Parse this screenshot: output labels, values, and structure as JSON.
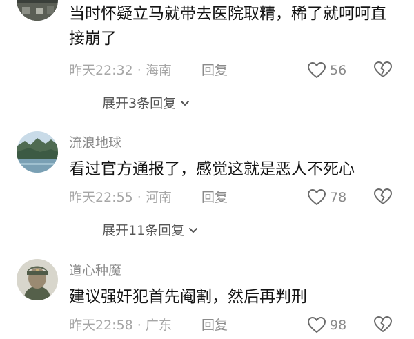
{
  "comments": [
    {
      "text": "当时怀疑立马就带去医院取精，稀了就呵呵直接崩了",
      "time": "昨天22:32",
      "location": "海南",
      "reply_label": "回复",
      "likes": "56",
      "expand_label": "展开3条回复"
    },
    {
      "username": "流浪地球",
      "text": "看过官方通报了，感觉这就是恶人不死心",
      "time": "昨天22:55",
      "location": "河南",
      "reply_label": "回复",
      "likes": "78",
      "expand_label": "展开11条回复"
    },
    {
      "username": "道心种魔",
      "text": "建议强奸犯首先阉割，然后再判刑",
      "time": "昨天22:58",
      "location": "广东",
      "reply_label": "回复",
      "likes": "98"
    }
  ],
  "meta_separator": "·",
  "icons": {
    "like": "heart-outline-icon",
    "dislike": "broken-heart-icon",
    "expand": "chevron-down-icon"
  },
  "colors": {
    "text": "#141414",
    "username": "#8a8a8a",
    "meta": "#a6a6a6",
    "icon": "#6b6b6b"
  }
}
